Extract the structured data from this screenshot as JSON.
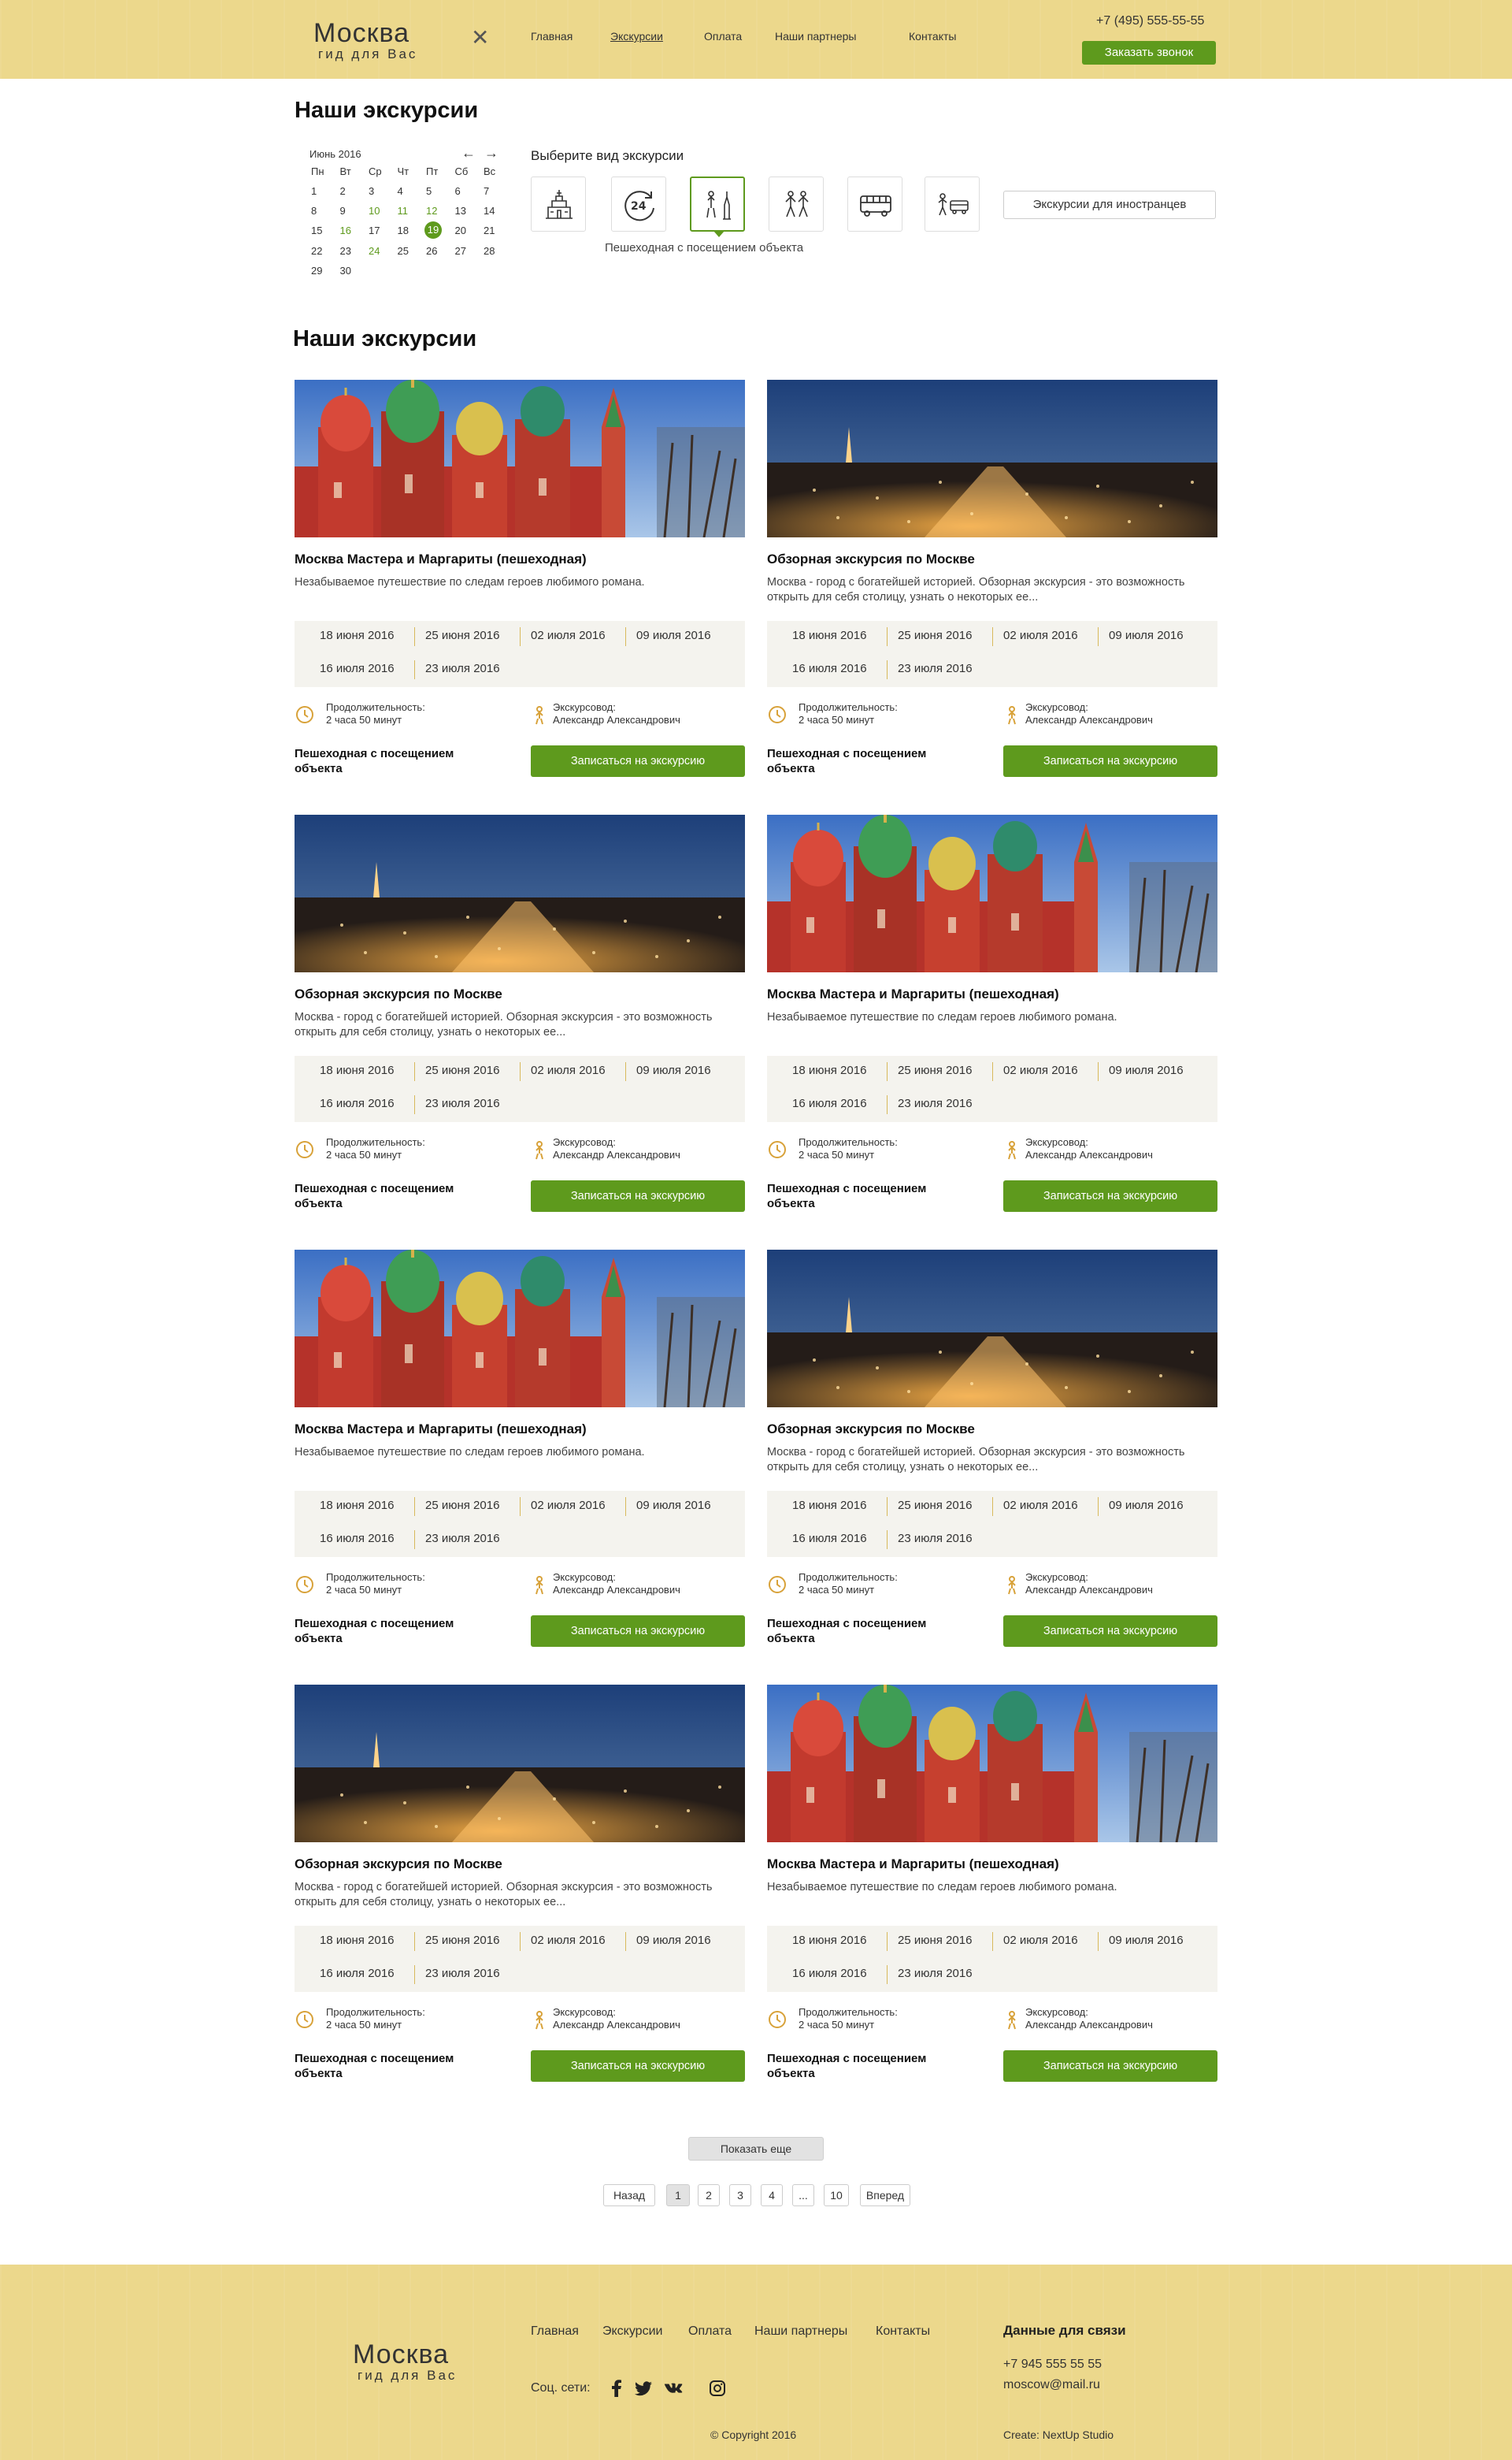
{
  "header": {
    "logo_title": "Москва",
    "logo_subtitle": "гид для Вас",
    "nav": [
      "Главная",
      "Экскурсии",
      "Оплата",
      "Наши партнеры",
      "Контакты"
    ],
    "active_nav": "Экскурсии",
    "phone": "+7 (495) 555-55-55",
    "callback_label": "Заказать звонок"
  },
  "filter": {
    "title": "Наши экскурсии",
    "calendar": {
      "month": "Июнь 2016",
      "prev": "←",
      "next": "→",
      "weekdays": [
        "Пн",
        "Вт",
        "Ср",
        "Чт",
        "Пт",
        "Сб",
        "Вс"
      ],
      "days": [
        "1",
        "2",
        "3",
        "4",
        "5",
        "6",
        "7",
        "8",
        "9",
        "10",
        "11",
        "12",
        "13",
        "14",
        "15",
        "16",
        "17",
        "18",
        "19",
        "20",
        "21",
        "22",
        "23",
        "24",
        "25",
        "26",
        "27",
        "28",
        "29",
        "30"
      ],
      "highlighted_days": [
        "10",
        "11",
        "12",
        "16",
        "24"
      ],
      "selected_day": "19"
    },
    "types_title": "Выберите вид экскурсии",
    "types": [
      "kremlin-icon",
      "24h-icon",
      "walking-object-icon",
      "walking-people-icon",
      "bus-icon",
      "walk-bus-icon"
    ],
    "active_type_caption": "Пешеходная с посещением объекта",
    "foreign_label": "Экскурсии для иностранцев"
  },
  "list_title": "Наши экскурсии",
  "card_labels": {
    "duration_label": "Продолжительность:",
    "duration_value": "2 часа 50 минут",
    "guide_label": "Экскурсовод:",
    "guide_value": "Александр Александрович",
    "type": "Пешеходная с посещением объекта",
    "enroll": "Записаться на экскурсию"
  },
  "dates": [
    "18 июня 2016",
    "25 июня 2016",
    "02 июля 2016",
    "09 июля 2016",
    "16 июля 2016",
    "23 июля 2016"
  ],
  "tours": {
    "margarita": {
      "title": "Москва Мастера и Маргариты (пешеходная)",
      "desc": "Незабываемое путешествие по следам героев любимого романа."
    },
    "overview": {
      "title": "Обзорная экскурсия по Москве",
      "desc": "Москва - город с богатейшей историей. Обзорная экскурсия - это возможность открыть для себя столицу, узнать о некоторых ее..."
    }
  },
  "pagination": {
    "more": "Показать еще",
    "prev": "Назад",
    "pages": [
      "1",
      "2",
      "3",
      "4",
      "...",
      "10"
    ],
    "current": "1",
    "next": "Вперед"
  },
  "footer": {
    "logo_title": "Москва",
    "logo_subtitle": "гид для Вас",
    "nav": [
      "Главная",
      "Экскурсии",
      "Оплата",
      "Наши партнеры",
      "Контакты"
    ],
    "social_label": "Соц. сети:",
    "social": [
      "facebook-icon",
      "twitter-icon",
      "vk-icon",
      "instagram-icon"
    ],
    "contact_title": "Данные для связи",
    "phone": "+7 945 555 55 55",
    "email": "moscow@mail.ru",
    "copyright": "© Copyright 2016",
    "created": "Create: NextUp Studio"
  },
  "colors": {
    "accent": "#5e9a1d",
    "header_bg": "#ecd88c",
    "dates_bg": "#f4f3ee",
    "separator": "#d8b95b"
  }
}
